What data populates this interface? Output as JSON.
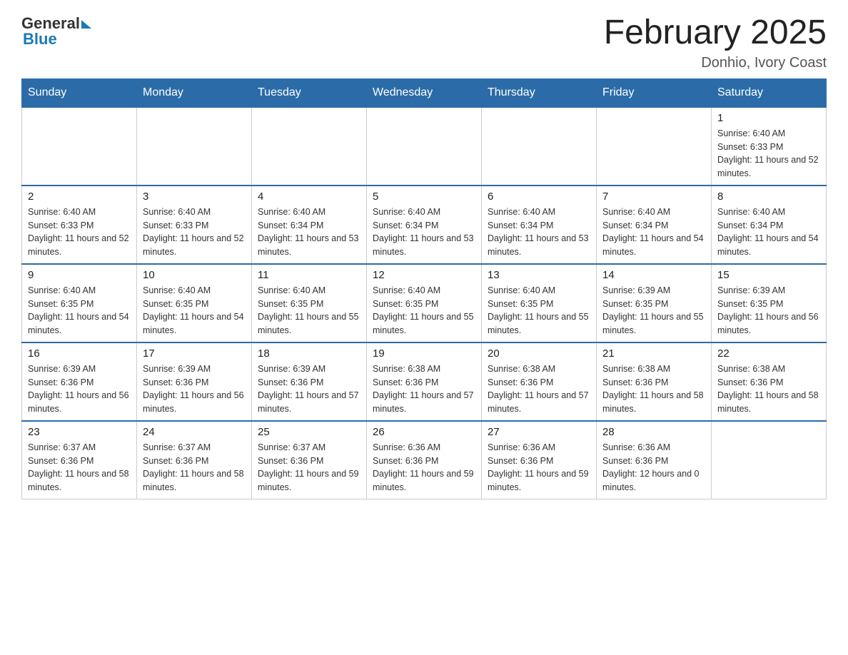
{
  "header": {
    "logo_general": "General",
    "logo_blue": "Blue",
    "month_title": "February 2025",
    "location": "Donhio, Ivory Coast"
  },
  "weekdays": [
    "Sunday",
    "Monday",
    "Tuesday",
    "Wednesday",
    "Thursday",
    "Friday",
    "Saturday"
  ],
  "weeks": [
    [
      {
        "day": "",
        "empty": true
      },
      {
        "day": "",
        "empty": true
      },
      {
        "day": "",
        "empty": true
      },
      {
        "day": "",
        "empty": true
      },
      {
        "day": "",
        "empty": true
      },
      {
        "day": "",
        "empty": true
      },
      {
        "day": "1",
        "sunrise": "6:40 AM",
        "sunset": "6:33 PM",
        "daylight": "11 hours and 52 minutes."
      }
    ],
    [
      {
        "day": "2",
        "sunrise": "6:40 AM",
        "sunset": "6:33 PM",
        "daylight": "11 hours and 52 minutes."
      },
      {
        "day": "3",
        "sunrise": "6:40 AM",
        "sunset": "6:33 PM",
        "daylight": "11 hours and 52 minutes."
      },
      {
        "day": "4",
        "sunrise": "6:40 AM",
        "sunset": "6:34 PM",
        "daylight": "11 hours and 53 minutes."
      },
      {
        "day": "5",
        "sunrise": "6:40 AM",
        "sunset": "6:34 PM",
        "daylight": "11 hours and 53 minutes."
      },
      {
        "day": "6",
        "sunrise": "6:40 AM",
        "sunset": "6:34 PM",
        "daylight": "11 hours and 53 minutes."
      },
      {
        "day": "7",
        "sunrise": "6:40 AM",
        "sunset": "6:34 PM",
        "daylight": "11 hours and 54 minutes."
      },
      {
        "day": "8",
        "sunrise": "6:40 AM",
        "sunset": "6:34 PM",
        "daylight": "11 hours and 54 minutes."
      }
    ],
    [
      {
        "day": "9",
        "sunrise": "6:40 AM",
        "sunset": "6:35 PM",
        "daylight": "11 hours and 54 minutes."
      },
      {
        "day": "10",
        "sunrise": "6:40 AM",
        "sunset": "6:35 PM",
        "daylight": "11 hours and 54 minutes."
      },
      {
        "day": "11",
        "sunrise": "6:40 AM",
        "sunset": "6:35 PM",
        "daylight": "11 hours and 55 minutes."
      },
      {
        "day": "12",
        "sunrise": "6:40 AM",
        "sunset": "6:35 PM",
        "daylight": "11 hours and 55 minutes."
      },
      {
        "day": "13",
        "sunrise": "6:40 AM",
        "sunset": "6:35 PM",
        "daylight": "11 hours and 55 minutes."
      },
      {
        "day": "14",
        "sunrise": "6:39 AM",
        "sunset": "6:35 PM",
        "daylight": "11 hours and 55 minutes."
      },
      {
        "day": "15",
        "sunrise": "6:39 AM",
        "sunset": "6:35 PM",
        "daylight": "11 hours and 56 minutes."
      }
    ],
    [
      {
        "day": "16",
        "sunrise": "6:39 AM",
        "sunset": "6:36 PM",
        "daylight": "11 hours and 56 minutes."
      },
      {
        "day": "17",
        "sunrise": "6:39 AM",
        "sunset": "6:36 PM",
        "daylight": "11 hours and 56 minutes."
      },
      {
        "day": "18",
        "sunrise": "6:39 AM",
        "sunset": "6:36 PM",
        "daylight": "11 hours and 57 minutes."
      },
      {
        "day": "19",
        "sunrise": "6:38 AM",
        "sunset": "6:36 PM",
        "daylight": "11 hours and 57 minutes."
      },
      {
        "day": "20",
        "sunrise": "6:38 AM",
        "sunset": "6:36 PM",
        "daylight": "11 hours and 57 minutes."
      },
      {
        "day": "21",
        "sunrise": "6:38 AM",
        "sunset": "6:36 PM",
        "daylight": "11 hours and 58 minutes."
      },
      {
        "day": "22",
        "sunrise": "6:38 AM",
        "sunset": "6:36 PM",
        "daylight": "11 hours and 58 minutes."
      }
    ],
    [
      {
        "day": "23",
        "sunrise": "6:37 AM",
        "sunset": "6:36 PM",
        "daylight": "11 hours and 58 minutes."
      },
      {
        "day": "24",
        "sunrise": "6:37 AM",
        "sunset": "6:36 PM",
        "daylight": "11 hours and 58 minutes."
      },
      {
        "day": "25",
        "sunrise": "6:37 AM",
        "sunset": "6:36 PM",
        "daylight": "11 hours and 59 minutes."
      },
      {
        "day": "26",
        "sunrise": "6:36 AM",
        "sunset": "6:36 PM",
        "daylight": "11 hours and 59 minutes."
      },
      {
        "day": "27",
        "sunrise": "6:36 AM",
        "sunset": "6:36 PM",
        "daylight": "11 hours and 59 minutes."
      },
      {
        "day": "28",
        "sunrise": "6:36 AM",
        "sunset": "6:36 PM",
        "daylight": "12 hours and 0 minutes."
      },
      {
        "day": "",
        "empty": true
      }
    ]
  ],
  "labels": {
    "sunrise_prefix": "Sunrise: ",
    "sunset_prefix": "Sunset: ",
    "daylight_prefix": "Daylight: "
  }
}
